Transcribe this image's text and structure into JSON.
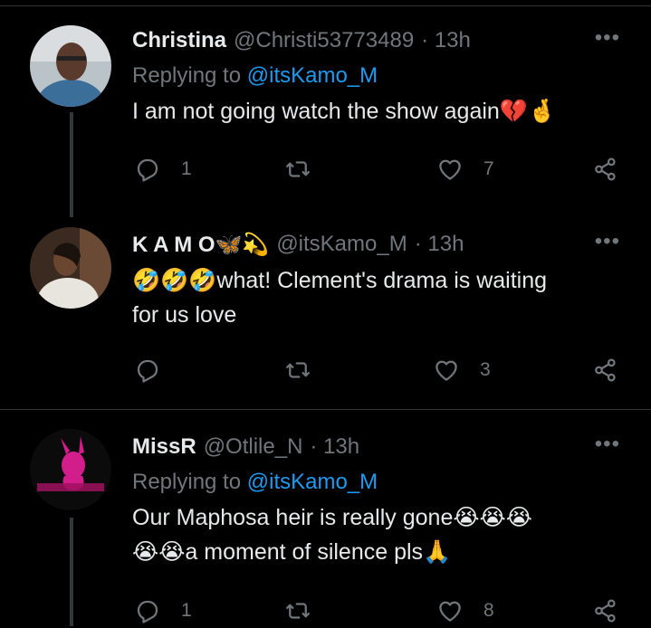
{
  "tweets": [
    {
      "name": "Christina",
      "handle": "@Christi53773489",
      "time": "· 13h",
      "replying_prefix": "Replying to ",
      "replying_handle": "@itsKamo_M",
      "text_lines": [
        "I am not going watch the show again💔🤞"
      ],
      "reply_count": "1",
      "retweet_count": "",
      "like_count": "7",
      "more": "•••"
    },
    {
      "name": "K A M O🦋💫",
      "handle": "@itsKamo_M",
      "time": "· 13h",
      "text_lines": [
        "🤣🤣🤣what! Clement's drama is waiting",
        "for us love"
      ],
      "reply_count": "",
      "retweet_count": "",
      "like_count": "3",
      "more": "•••"
    },
    {
      "name": "MissR",
      "handle": "@Otlile_N",
      "time": "· 13h",
      "replying_prefix": "Replying to ",
      "replying_handle": "@itsKamo_M",
      "text_lines": [
        "Our Maphosa heir is really gone😭😭😭",
        "😭😭a moment of silence pls🙏"
      ],
      "reply_count": "1",
      "retweet_count": "",
      "like_count": "8",
      "more": "•••"
    }
  ],
  "colors": {
    "background": "#000000",
    "text": "#e7e9ea",
    "muted": "#71767b",
    "link": "#1d9bf0",
    "divider": "#2f3336"
  },
  "icons": [
    "reply-icon",
    "retweet-icon",
    "like-icon",
    "share-icon",
    "more-icon"
  ]
}
